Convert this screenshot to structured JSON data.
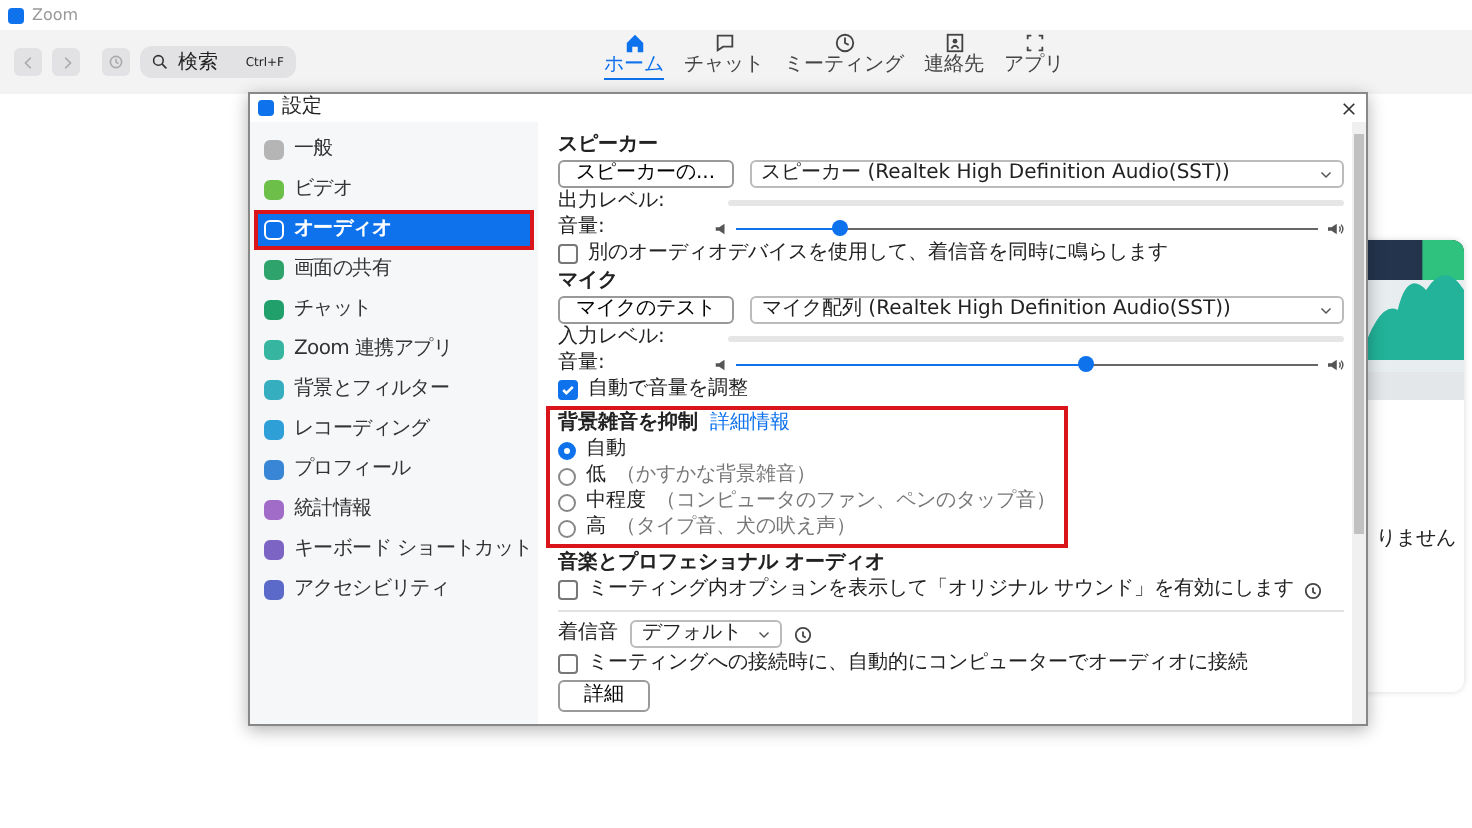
{
  "app": {
    "title": "Zoom"
  },
  "toolbar": {
    "search": {
      "placeholder": "検索",
      "shortcut": "Ctrl+F"
    },
    "tabs": [
      {
        "label": "ホーム",
        "selected": true
      },
      {
        "label": "チャット",
        "selected": false
      },
      {
        "label": "ミーティング",
        "selected": false
      },
      {
        "label": "連絡先",
        "selected": false
      },
      {
        "label": "アプリ",
        "selected": false
      }
    ]
  },
  "background_card": {
    "text": "りません"
  },
  "settings": {
    "title": "設定",
    "sidebar": [
      {
        "label": "一般",
        "selected": false,
        "highlighted": false,
        "color": "#b5b5b5"
      },
      {
        "label": "ビデオ",
        "selected": false,
        "highlighted": false,
        "color": "#6cc04a"
      },
      {
        "label": "オーディオ",
        "selected": true,
        "highlighted": true,
        "color": "#ffffff"
      },
      {
        "label": "画面の共有",
        "selected": false,
        "highlighted": false,
        "color": "#2ea36b"
      },
      {
        "label": "チャット",
        "selected": false,
        "highlighted": false,
        "color": "#22a06b"
      },
      {
        "label": "Zoom 連携アプリ",
        "selected": false,
        "highlighted": false,
        "color": "#36b6a0"
      },
      {
        "label": "背景とフィルター",
        "selected": false,
        "highlighted": false,
        "color": "#35aebf"
      },
      {
        "label": "レコーディング",
        "selected": false,
        "highlighted": false,
        "color": "#2f9fd8"
      },
      {
        "label": "プロフィール",
        "selected": false,
        "highlighted": false,
        "color": "#3a86d6"
      },
      {
        "label": "統計情報",
        "selected": false,
        "highlighted": false,
        "color": "#a06cc8"
      },
      {
        "label": "キーボード ショートカット",
        "selected": false,
        "highlighted": false,
        "color": "#7b64c4"
      },
      {
        "label": "アクセシビリティ",
        "selected": false,
        "highlighted": false,
        "color": "#5b6ac8"
      }
    ],
    "speaker": {
      "heading": "スピーカー",
      "test_button": "スピーカーの...",
      "device": "スピーカー (Realtek High Definition Audio(SST))",
      "output_meter": {
        "label": "出力レベル:",
        "level": 0
      },
      "volume": {
        "label": "音量:",
        "level": 0.18
      }
    },
    "ring_checkbox": {
      "label": "別のオーディオデバイスを使用して、着信音を同時に鳴らします",
      "checked": false
    },
    "mic": {
      "heading": "マイク",
      "test_button": "マイクのテスト",
      "device": "マイク配列 (Realtek High Definition Audio(SST))",
      "input_meter": {
        "label": "入力レベル:",
        "level": 0
      },
      "volume": {
        "label": "音量:",
        "level": 0.6
      }
    },
    "auto_adjust": {
      "label": "自動で音量を調整",
      "checked": true
    },
    "noise": {
      "heading": "背景雑音を抑制",
      "link": "詳細情報",
      "highlighted": true,
      "options": [
        {
          "label": "自動",
          "selected": true
        },
        {
          "label": "低",
          "note": "（かすかな背景雑音）",
          "selected": false
        },
        {
          "label": "中程度",
          "note": "（コンピュータのファン、ペンのタップ音）",
          "selected": false
        },
        {
          "label": "高",
          "note": "（タイプ音、犬の吠え声）",
          "selected": false
        }
      ]
    },
    "music": {
      "heading": "音楽とプロフェショナル オーディオ",
      "checkbox": {
        "label": "ミーティング内オプションを表示して「オリジナル サウンド」を有効にします",
        "checked": false
      }
    },
    "ringtone": {
      "label": "着信音",
      "value": "デフォルト"
    },
    "auto_join": {
      "label": "ミーティングへの接続時に、自動的にコンピューターでオーディオに接続",
      "checked": false
    },
    "advanced_button": "詳細"
  }
}
